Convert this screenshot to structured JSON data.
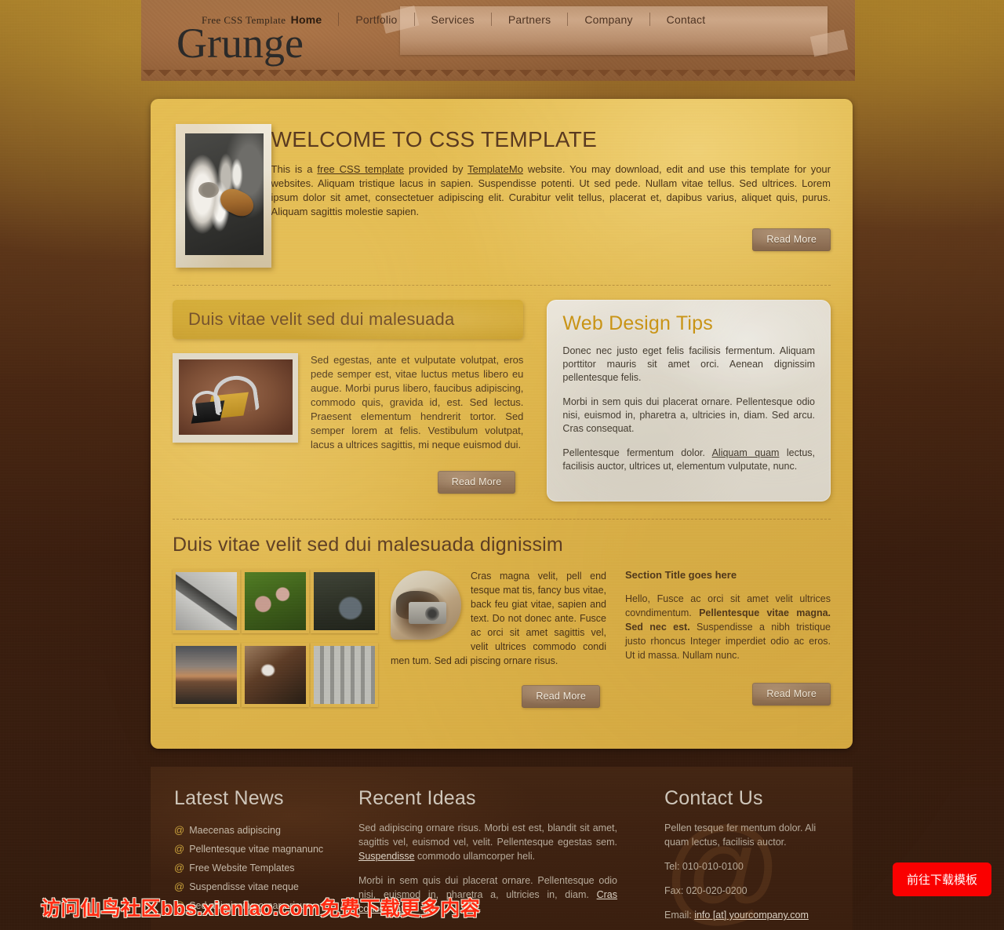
{
  "header": {
    "logo_sub": "Free CSS Template",
    "logo_name": "Grunge",
    "nav": [
      {
        "label": "Home",
        "active": true
      },
      {
        "label": "Portfolio",
        "active": false
      },
      {
        "label": "Services",
        "active": false
      },
      {
        "label": "Partners",
        "active": false
      },
      {
        "label": "Company",
        "active": false
      },
      {
        "label": "Contact",
        "active": false
      }
    ]
  },
  "welcome": {
    "title": "WELCOME TO CSS TEMPLATE",
    "body_part1": "This is a ",
    "link1": "free CSS template",
    "body_part2": " provided by ",
    "link2": "TemplateMo",
    "body_part3": " website. You may download, edit and use this template for your websites. Aliquam tristique lacus in sapien. Suspendisse potenti. Ut sed pede. Nullam vitae tellus. Sed ultrices. Lorem ipsum dolor sit amet, consectetuer adipiscing elit. Curabitur velit tellus, placerat et, dapibus varius, aliquet quis, purus. Aliquam sagittis molestie sapien.",
    "read_more": "Read More",
    "image_alt": "flower-beetle-photo"
  },
  "middle": {
    "heading": "Duis vitae velit sed dui malesuada",
    "body": "Sed egestas, ante et vulputate volutpat, eros pede semper est, vitae luctus metus libero eu augue. Morbi purus libero, faucibus adipiscing, commodo quis, gravida id, est. Sed lectus. Praesent elementum hendrerit tortor. Sed semper lorem at felis. Vestibulum volutpat, lacus a ultrices sagittis, mi neque euismod dui.",
    "read_more": "Read More",
    "image_alt": "binder-clips-photo"
  },
  "tips": {
    "title": "Web Design Tips",
    "p1": "Donec nec justo eget felis facilisis fermentum. Aliquam porttitor mauris sit amet orci. Aenean dignissim pellentesque felis.",
    "p2": "Morbi in sem quis dui placerat ornare. Pellentesque odio nisi, euismod in, pharetra a, ultricies in, diam. Sed arcu. Cras consequat.",
    "p3_before": "Pellentesque fermentum dolor. ",
    "p3_link": "Aliquam quam",
    "p3_after": " lectus, facilisis auctor, ultrices ut, elementum vulputate, nunc."
  },
  "gallery": {
    "heading": "Duis vitae velit sed dui malesuada dignissim",
    "thumbs": [
      {
        "alt": "spiral-spring-thumb"
      },
      {
        "alt": "orchid-flowers-thumb"
      },
      {
        "alt": "ducks-thumb"
      },
      {
        "alt": "sunset-lake-thumb"
      },
      {
        "alt": "cat-face-thumb"
      },
      {
        "alt": "arches-corridor-thumb"
      }
    ],
    "text": "Cras magna velit, pell end tesque mat tis, fancy bus vitae, back feu giat vitae, sapien and text. Do not donec ante. Fusce ac orci sit amet sagittis vel, velit ultrices commodo condi men tum. Sed adi piscing ornare risus.",
    "read_more": "Read More",
    "camera_alt": "vintage-camera-image",
    "right_title": "Section Title goes here",
    "right_before": "Hello, Fusce ac orci sit amet velit ultrices covndimentum. ",
    "right_bold1": "Pellentesque vitae magna. Sed nec est.",
    "right_after": " Suspendisse a nibh tristique justo rhoncus Integer imperdiet odio ac eros. Ut id massa. Nullam nunc.",
    "right_read_more": "Read More"
  },
  "footer": {
    "news_title": "Latest News",
    "news_items": [
      "Maecenas adipiscing",
      "Pellentesque vitae magnanunc",
      "Free Website Templates",
      "Suspendisse vitae neque",
      "Sed adi piscing ornare risus"
    ],
    "news_bullet": "@",
    "ideas_title": "Recent Ideas",
    "ideas_p1_before": "Sed adipiscing ornare risus. Morbi est est, blandit sit amet, sagittis vel, euismod vel, velit. Pellentesque egestas sem. ",
    "ideas_p1_link": "Suspendisse",
    "ideas_p1_after": " commodo ullamcorper heli.",
    "ideas_p2_before": "Morbi in sem quis dui placerat ornare. Pellentesque odio nisi, euismod in, pharetra a, ultricies in, diam. ",
    "ideas_p2_link": "Cras consequat",
    "contact_title": "Contact Us",
    "contact_p": "Pellen tesque fer mentum dolor. Ali quam lectus, facilisis auctor.",
    "tel": "Tel: 010-010-0100",
    "fax": "Fax: 020-020-0200",
    "email_label": "Email: ",
    "email_link": "info [at] yourcompany.com",
    "watermark_at": "@"
  },
  "overlay": {
    "watermark": "访问仙鸟社区bbs.xienIao.com免费下载更多内容",
    "download_button": "前往下载模板"
  },
  "colors": {
    "page_bg": "#3b2112",
    "header_bg": "#92603a",
    "content_bg": "#e2b94b",
    "bar_bg": "#cfa42c",
    "tips_bg": "#e3ded2",
    "tips_title": "#c99416",
    "footer_bg": "#3e2110",
    "button_bg": "#94765b",
    "accent_red": "#fa0000",
    "bullet_gold": "#c9a23c"
  }
}
